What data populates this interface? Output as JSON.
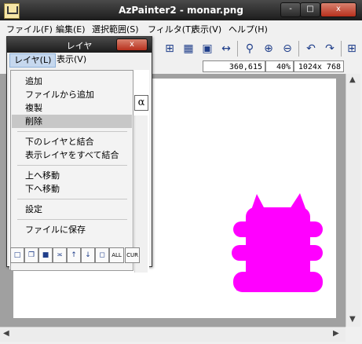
{
  "window": {
    "title": "AzPainter2 - monar.png",
    "minimize": "-",
    "maximize": "□",
    "close": "x"
  },
  "menu": [
    "ファイル(F)",
    "編集(E)",
    "選択範囲(S)",
    "フィルタ(T)",
    "表示(V)",
    "ヘルプ(H)"
  ],
  "toolbar": [
    "grid-icon",
    "checker-icon",
    "fit-icon",
    "zoom-icon",
    "zoom-in-icon",
    "zoom-out-icon",
    "undo-icon",
    "redo-icon"
  ],
  "status": {
    "coords": "360,615",
    "zoom": "40%",
    "size": "1024x 768"
  },
  "layer_panel": {
    "title": "レイヤ",
    "close": "x",
    "menus": [
      "レイヤ(L)",
      "表示(V)"
    ],
    "items": [
      "追加",
      "ファイルから追加",
      "複製",
      "削除",
      "下のレイヤと結合",
      "表示レイヤをすべて結合",
      "上へ移動",
      "下へ移動",
      "設定",
      "ファイルに保存"
    ],
    "selected_item": "削除",
    "alpha": "α",
    "button_labels": [
      "ALL",
      "CUR"
    ]
  },
  "colors": {
    "figure": "#ff00ff",
    "canvas": "#ffffff",
    "workspace": "#a0a0a0"
  }
}
